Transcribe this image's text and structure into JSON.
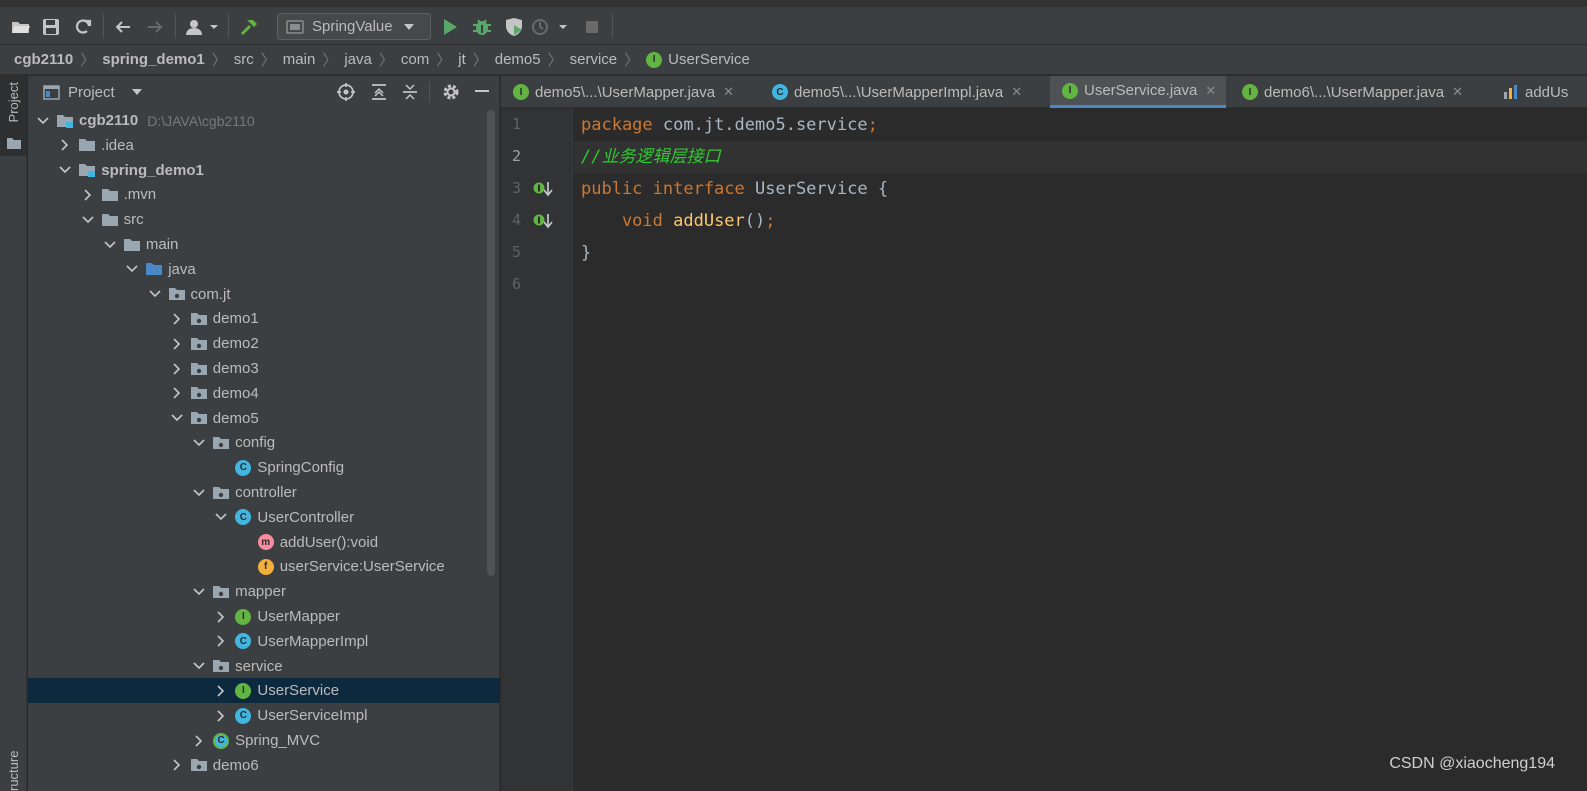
{
  "toolbar": {
    "run_config": "SpringValue",
    "icons": [
      "open-folder-icon",
      "save-icon",
      "sync-icon",
      "back-icon",
      "forward-icon",
      "vcs-user-icon",
      "build-hammer-icon",
      "run-icon",
      "debug-icon",
      "coverage-icon",
      "profile-icon",
      "stop-icon"
    ]
  },
  "breadcrumb": [
    "cgb2110",
    "spring_demo1",
    "src",
    "main",
    "java",
    "com",
    "jt",
    "demo5",
    "service",
    "UserService"
  ],
  "sidestrip": {
    "project_tab": "Project",
    "structure_tab": "ructure"
  },
  "project_panel": {
    "title": "Project",
    "tree": [
      {
        "label": "cgb2110",
        "path": "D:\\JAVA\\cgb2110",
        "depth": 0,
        "chev": "down",
        "icon": "module",
        "bold": true
      },
      {
        "label": ".idea",
        "depth": 1,
        "chev": "right",
        "icon": "folder"
      },
      {
        "label": "spring_demo1",
        "depth": 1,
        "chev": "down",
        "icon": "module",
        "bold": true
      },
      {
        "label": ".mvn",
        "depth": 2,
        "chev": "right",
        "icon": "folder"
      },
      {
        "label": "src",
        "depth": 2,
        "chev": "down",
        "icon": "folder"
      },
      {
        "label": "main",
        "depth": 3,
        "chev": "down",
        "icon": "folder"
      },
      {
        "label": "java",
        "depth": 4,
        "chev": "down",
        "icon": "src-folder"
      },
      {
        "label": "com.jt",
        "depth": 5,
        "chev": "down",
        "icon": "package"
      },
      {
        "label": "demo1",
        "depth": 6,
        "chev": "right",
        "icon": "package"
      },
      {
        "label": "demo2",
        "depth": 6,
        "chev": "right",
        "icon": "package"
      },
      {
        "label": "demo3",
        "depth": 6,
        "chev": "right",
        "icon": "package"
      },
      {
        "label": "demo4",
        "depth": 6,
        "chev": "right",
        "icon": "package"
      },
      {
        "label": "demo5",
        "depth": 6,
        "chev": "down",
        "icon": "package"
      },
      {
        "label": "config",
        "depth": 7,
        "chev": "down",
        "icon": "package"
      },
      {
        "label": "SpringConfig",
        "depth": 8,
        "chev": "none",
        "icon": "class"
      },
      {
        "label": "controller",
        "depth": 7,
        "chev": "down",
        "icon": "package"
      },
      {
        "label": "UserController",
        "depth": 8,
        "chev": "down",
        "icon": "class"
      },
      {
        "label": "addUser():void",
        "depth": 9,
        "chev": "none",
        "icon": "method"
      },
      {
        "label": "userService:UserService",
        "depth": 9,
        "chev": "none",
        "icon": "field"
      },
      {
        "label": "mapper",
        "depth": 7,
        "chev": "down",
        "icon": "package"
      },
      {
        "label": "UserMapper",
        "depth": 8,
        "chev": "right",
        "icon": "interface"
      },
      {
        "label": "UserMapperImpl",
        "depth": 8,
        "chev": "right",
        "icon": "class"
      },
      {
        "label": "service",
        "depth": 7,
        "chev": "down",
        "icon": "package"
      },
      {
        "label": "UserService",
        "depth": 8,
        "chev": "right",
        "icon": "interface",
        "selected": true
      },
      {
        "label": "UserServiceImpl",
        "depth": 8,
        "chev": "right",
        "icon": "class"
      },
      {
        "label": "Spring_MVC",
        "depth": 7,
        "chev": "right",
        "icon": "spring-class"
      },
      {
        "label": "demo6",
        "depth": 6,
        "chev": "right",
        "icon": "package"
      }
    ]
  },
  "tabs": [
    {
      "label": "demo5\\...\\UserMapper.java",
      "icon": "interface",
      "active": false,
      "close": "✕"
    },
    {
      "label": "demo5\\...\\UserMapperImpl.java",
      "icon": "class",
      "active": false,
      "close": "✕"
    },
    {
      "label": "UserService.java",
      "icon": "interface",
      "active": true,
      "close": "✕"
    },
    {
      "label": "demo6\\...\\UserMapper.java",
      "icon": "interface",
      "active": false,
      "close": "✕"
    },
    {
      "label": "addUs",
      "icon": "chart-file",
      "active": false,
      "close": ""
    }
  ],
  "editor": {
    "line_numbers": [
      "1",
      "2",
      "3",
      "4",
      "5",
      "6"
    ],
    "lines": [
      [
        {
          "t": "package ",
          "c": "kw"
        },
        {
          "t": "com.jt.demo5.service",
          "c": "id"
        },
        {
          "t": ";",
          "c": "kw"
        }
      ],
      [
        {
          "t": "//业务逻辑层接口",
          "c": "cm"
        }
      ],
      [
        {
          "t": "public interface ",
          "c": "kw"
        },
        {
          "t": "UserService {",
          "c": "id"
        }
      ],
      [
        {
          "t": "    void ",
          "c": "kw"
        },
        {
          "t": "addUser",
          "c": "fn"
        },
        {
          "t": "()",
          "c": "id"
        },
        {
          "t": ";",
          "c": "kw"
        }
      ],
      [
        {
          "t": "}",
          "c": "id"
        }
      ],
      []
    ],
    "current_line": 2,
    "gutter_marks": [
      3,
      4
    ]
  },
  "watermark": "CSDN @xiaocheng194",
  "colors": {
    "keyword": "#cc7832",
    "identifier": "#a9b7c6",
    "method": "#ffc66d",
    "comment": "#32c832",
    "selection": "#0d293e",
    "accent": "#4a88c7"
  }
}
